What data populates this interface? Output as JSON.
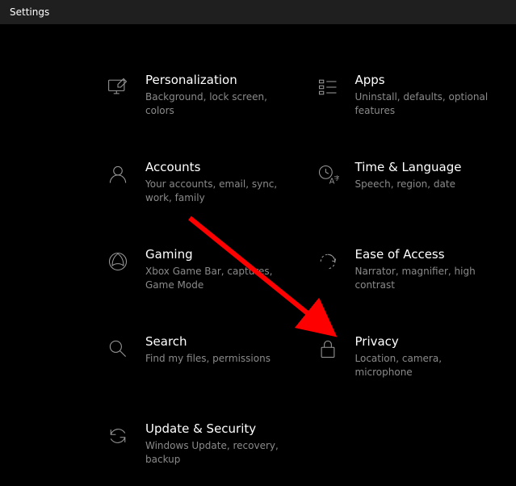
{
  "window": {
    "title": "Settings"
  },
  "tiles": [
    {
      "title": "Personalization",
      "desc": "Background, lock screen, colors"
    },
    {
      "title": "Apps",
      "desc": "Uninstall, defaults, optional features"
    },
    {
      "title": "Accounts",
      "desc": "Your accounts, email, sync, work, family"
    },
    {
      "title": "Time & Language",
      "desc": "Speech, region, date"
    },
    {
      "title": "Gaming",
      "desc": "Xbox Game Bar, captures, Game Mode"
    },
    {
      "title": "Ease of Access",
      "desc": "Narrator, magnifier, high contrast"
    },
    {
      "title": "Search",
      "desc": "Find my files, permissions"
    },
    {
      "title": "Privacy",
      "desc": "Location, camera, microphone"
    },
    {
      "title": "Update & Security",
      "desc": "Windows Update, recovery, backup"
    }
  ]
}
